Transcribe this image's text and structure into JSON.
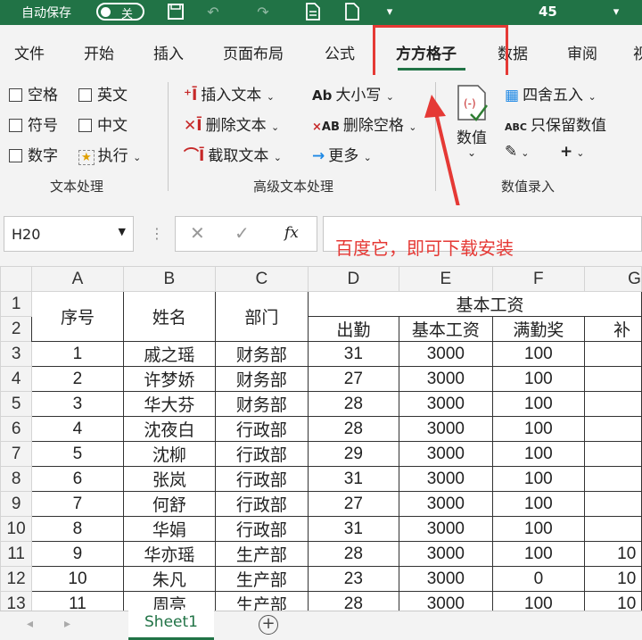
{
  "titlebar": {
    "autosave_label": "自动保存",
    "autosave_state": "关",
    "page_count": "45",
    "icons": [
      "save-icon",
      "undo-icon",
      "redo-icon",
      "document-icon",
      "file-icon",
      "customize-icon"
    ]
  },
  "ribbon_tabs": [
    "文件",
    "开始",
    "插入",
    "页面布局",
    "公式",
    "方方格子",
    "数据",
    "审阅",
    "视"
  ],
  "active_tab": "方方格子",
  "ribbon": {
    "text_processing": {
      "items": [
        "空格",
        "英文",
        "符号",
        "中文",
        "数字",
        "执行"
      ],
      "group_label": "文本处理"
    },
    "advanced_text": {
      "items": [
        "插入文本",
        "删除文本",
        "截取文本",
        "大小写",
        "删除空格",
        "更多"
      ],
      "group_label": "高级文本处理"
    },
    "numeric_entry": {
      "value_label": "数值",
      "round_label": "四舍五入",
      "keep_values_label": "只保留数值",
      "group_label": "数值录入"
    }
  },
  "formula_bar": {
    "name_box": "H20",
    "fx": "fx",
    "annotation": "百度它，即可下载安装"
  },
  "sheet": {
    "col_headers": [
      "A",
      "B",
      "C",
      "D",
      "E",
      "F",
      "G"
    ],
    "merged_header": "基本工资",
    "header_row1": [
      "序号",
      "姓名",
      "部门"
    ],
    "header_row2": [
      "出勤",
      "基本工资",
      "满勤奖",
      "补"
    ],
    "rows": [
      {
        "n": "3",
        "a": "1",
        "b": "戚之瑶",
        "c": "财务部",
        "d": "31",
        "e": "3000",
        "f": "100",
        "g": ""
      },
      {
        "n": "4",
        "a": "2",
        "b": "许梦娇",
        "c": "财务部",
        "d": "27",
        "e": "3000",
        "f": "100",
        "g": ""
      },
      {
        "n": "5",
        "a": "3",
        "b": "华大芬",
        "c": "财务部",
        "d": "28",
        "e": "3000",
        "f": "100",
        "g": ""
      },
      {
        "n": "6",
        "a": "4",
        "b": "沈夜白",
        "c": "行政部",
        "d": "28",
        "e": "3000",
        "f": "100",
        "g": ""
      },
      {
        "n": "7",
        "a": "5",
        "b": "沈柳",
        "c": "行政部",
        "d": "29",
        "e": "3000",
        "f": "100",
        "g": ""
      },
      {
        "n": "8",
        "a": "6",
        "b": "张岚",
        "c": "行政部",
        "d": "31",
        "e": "3000",
        "f": "100",
        "g": ""
      },
      {
        "n": "9",
        "a": "7",
        "b": "何舒",
        "c": "行政部",
        "d": "27",
        "e": "3000",
        "f": "100",
        "g": ""
      },
      {
        "n": "10",
        "a": "8",
        "b": "华娟",
        "c": "行政部",
        "d": "31",
        "e": "3000",
        "f": "100",
        "g": ""
      },
      {
        "n": "11",
        "a": "9",
        "b": "华亦瑶",
        "c": "生产部",
        "d": "28",
        "e": "3000",
        "f": "100",
        "g": "10"
      },
      {
        "n": "12",
        "a": "10",
        "b": "朱凡",
        "c": "生产部",
        "d": "23",
        "e": "3000",
        "f": "0",
        "g": "10"
      },
      {
        "n": "13",
        "a": "11",
        "b": "周亮",
        "c": "生产部",
        "d": "28",
        "e": "3000",
        "f": "100",
        "g": "10"
      }
    ]
  },
  "sheet_tabs": [
    "Sheet1"
  ]
}
